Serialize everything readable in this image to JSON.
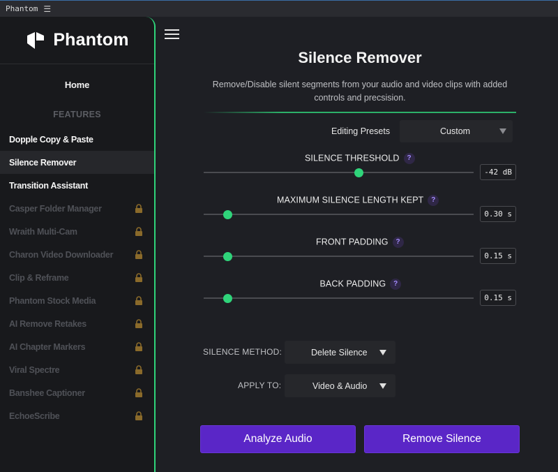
{
  "window": {
    "title": "Phantom",
    "menu_glyph": "☰"
  },
  "brand": {
    "name": "Phantom",
    "accent": "#2fd47a",
    "button_color": "#5a26c7"
  },
  "sidebar": {
    "home_label": "Home",
    "features_label": "FEATURES",
    "items": [
      {
        "label": "Dopple Copy & Paste",
        "locked": false,
        "active": false
      },
      {
        "label": "Silence Remover",
        "locked": false,
        "active": true
      },
      {
        "label": "Transition Assistant",
        "locked": false,
        "active": false
      },
      {
        "label": "Casper Folder Manager",
        "locked": true,
        "icon": "lock-icon"
      },
      {
        "label": "Wraith Multi-Cam",
        "locked": true,
        "icon": "lock-icon"
      },
      {
        "label": "Charon Video Downloader",
        "locked": true,
        "icon": "lock-icon"
      },
      {
        "label": "Clip & Reframe",
        "locked": true,
        "icon": "lock-icon"
      },
      {
        "label": "Phantom Stock Media",
        "locked": true,
        "icon": "lock-icon"
      },
      {
        "label": "AI Remove Retakes",
        "locked": true,
        "icon": "lock-icon"
      },
      {
        "label": "AI Chapter Markers",
        "locked": true,
        "icon": "lock-icon"
      },
      {
        "label": "Viral Spectre",
        "locked": true,
        "icon": "lock-icon"
      },
      {
        "label": "Banshee Captioner",
        "locked": true,
        "icon": "lock-icon"
      },
      {
        "label": "EchoeScribe",
        "locked": true,
        "icon": "lock-icon"
      }
    ]
  },
  "main": {
    "title": "Silence Remover",
    "subtitle": "Remove/Disable silent segments from your audio and video clips with added controls and precsision.",
    "presets": {
      "label": "Editing Presets",
      "value": "Custom"
    },
    "sliders": [
      {
        "title": "SILENCE THRESHOLD",
        "help": "?",
        "display": "-42 dB",
        "fraction": 0.575
      },
      {
        "title": "MAXIMUM SILENCE LENGTH KEPT",
        "help": "?",
        "display": "0.30 s",
        "fraction": 0.088
      },
      {
        "title": "FRONT PADDING",
        "help": "?",
        "display": "0.15 s",
        "fraction": 0.09
      },
      {
        "title": "BACK PADDING",
        "help": "?",
        "display": "0.15 s",
        "fraction": 0.09
      }
    ],
    "silence_method": {
      "label": "SILENCE METHOD:",
      "value": "Delete Silence"
    },
    "apply_to": {
      "label": "APPLY TO:",
      "value": "Video & Audio"
    },
    "analyze_button": "Analyze Audio",
    "remove_button": "Remove Silence"
  }
}
